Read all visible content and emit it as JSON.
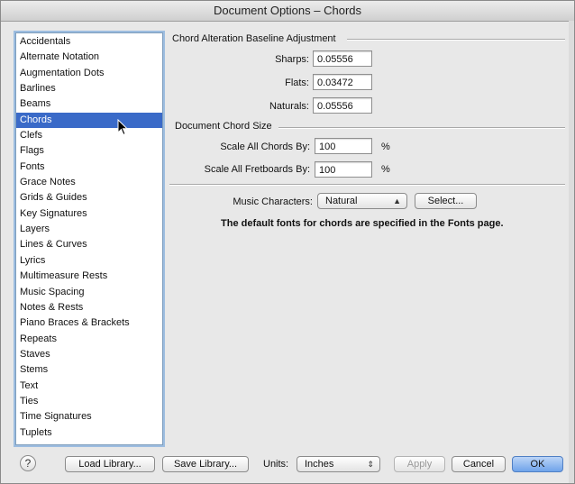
{
  "window": {
    "title": "Document Options – Chords"
  },
  "sidebar": {
    "selected_index": 5,
    "items": [
      {
        "label": "Accidentals"
      },
      {
        "label": "Alternate Notation"
      },
      {
        "label": "Augmentation Dots"
      },
      {
        "label": "Barlines"
      },
      {
        "label": "Beams"
      },
      {
        "label": "Chords"
      },
      {
        "label": "Clefs"
      },
      {
        "label": "Flags"
      },
      {
        "label": "Fonts"
      },
      {
        "label": "Grace Notes"
      },
      {
        "label": "Grids & Guides"
      },
      {
        "label": "Key Signatures"
      },
      {
        "label": "Layers"
      },
      {
        "label": "Lines & Curves"
      },
      {
        "label": "Lyrics"
      },
      {
        "label": "Multimeasure Rests"
      },
      {
        "label": "Music Spacing"
      },
      {
        "label": "Notes & Rests"
      },
      {
        "label": "Piano Braces & Brackets"
      },
      {
        "label": "Repeats"
      },
      {
        "label": "Staves"
      },
      {
        "label": "Stems"
      },
      {
        "label": "Text"
      },
      {
        "label": "Ties"
      },
      {
        "label": "Time Signatures"
      },
      {
        "label": "Tuplets"
      }
    ]
  },
  "baseline": {
    "heading": "Chord Alteration Baseline Adjustment",
    "sharps_label": "Sharps:",
    "sharps_value": "0.05556",
    "flats_label": "Flats:",
    "flats_value": "0.03472",
    "naturals_label": "Naturals:",
    "naturals_value": "0.05556"
  },
  "size": {
    "heading": "Document Chord Size",
    "chords_label": "Scale All Chords By:",
    "chords_value": "100",
    "chords_unit": "%",
    "fretboards_label": "Scale All Fretboards By:",
    "fretboards_value": "100",
    "fretboards_unit": "%"
  },
  "music": {
    "label": "Music Characters:",
    "selected": "Natural",
    "select_button": "Select...",
    "note": "The default fonts for chords are specified in the Fonts page."
  },
  "footer": {
    "help": "?",
    "load_library": "Load Library...",
    "save_library": "Save Library...",
    "units_label": "Units:",
    "units_value": "Inches",
    "apply": "Apply",
    "cancel": "Cancel",
    "ok": "OK"
  },
  "colors": {
    "selection": "#3a6ac8",
    "default_button": "#6fa3ea",
    "focus_ring": "#9dbde0"
  }
}
